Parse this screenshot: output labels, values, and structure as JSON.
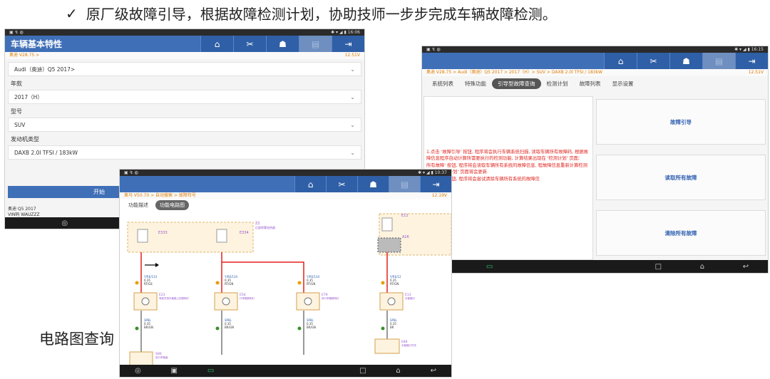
{
  "headline": {
    "check": "✓",
    "text": "原厂级故障引导，根据故障检测计划，协助技师一步步完成车辆故障检测。"
  },
  "caption": "电路图查询",
  "toolbar_icons": [
    "home-icon",
    "tools-icon",
    "user-icon",
    "print-icon",
    "exit-icon"
  ],
  "screen1": {
    "title": "车辆基本特性",
    "version": "奥迪 V28.75 >",
    "voltage": "12.51V",
    "model_select": "Audi（奥迪）Q5 2017>",
    "year_label": "年款",
    "year_value": "2017（H）",
    "type_label": "型号",
    "type_value": "SUV",
    "engine_label": "发动机类型",
    "engine_value": "DAXB 2.0l TFSI / 183kW",
    "start_button": "开始",
    "vehicle_line1": "奥迪 Q5 2017",
    "vehicle_line2": "VIN码 WAUZZZ"
  },
  "screen2": {
    "breadcrumb": "奥迪 V28.75 > Audi（奥迪）Q5 2017 > 2017（H）> SUV > DAXB 2.0l TFSI / 183kW",
    "voltage": "12.51V",
    "tabs": [
      "系统列表",
      "特殊功能",
      "引导型故障查询",
      "检测计划",
      "故障列表",
      "显示设置"
    ],
    "active_tab": 2,
    "guide_lines": [
      "1.点击 '故障引导' 按钮, 程序将会执行车辆系统扫描, 读取车辆所有故障码, 根据故障信息程序自动计算所需要执行的检测功能, 计算结果出现在 '检测计划' 页面;",
      "所有故障' 按钮, 程序将会读取车辆所有系统的故障信息, 程故障信息重新计算检测功能, '检测计划' 页面将会更新.",
      "所有故障' 按钮, 程序将会尝试清除车辆所有系统的故障信"
    ],
    "buttons": [
      "故障引导",
      "读取所有故障",
      "清除所有故障"
    ]
  },
  "screen3": {
    "breadcrumb": "奥马 V50.70 > 自动搜索 > 故障符号",
    "voltage": "12.19V",
    "tabs": [
      "功能描述",
      "功能电路图"
    ],
    "active_tab": 1,
    "labels": {
      "e333": "E333",
      "e334": "E334",
      "z2_a": "Z2",
      "z2_b": "后窗除雾加热器",
      "e12": "E12",
      "a26": "A26",
      "wire_1a": "Y/RE/133",
      "wire_1b": "0.35",
      "wire_1c": "RT/GE",
      "wire_2a": "Y/RE/134",
      "wire_2b": "0.35",
      "wire_2c": "RT/GN",
      "wire_3a": "Y/RE/134",
      "wire_3b": "0.35",
      "wire_3c": "RT/GN",
      "wire_4a": "Y/RE/12",
      "wire_4b": "0.35",
      "wire_4c": "RT/GN",
      "e_1": "E23",
      "e_1b": "驾驶员侧手套箱上的照明灯",
      "e_2": "E54",
      "e_2b": "行李箱照明灯",
      "e_3": "E79",
      "e_3b": "前行李箱照明灯",
      "e_4": "E13",
      "e_4b": "手套箱灯",
      "gnd_1a": "SP8L",
      "gnd_1b": "0.35",
      "gnd_1c": "BR/GN",
      "gnd_2a": "SP8L",
      "gnd_2b": "0.35",
      "gnd_2c": "BR/GN",
      "gnd_3a": "SP8L",
      "gnd_3b": "0.35",
      "gnd_3c": "BR/GN",
      "gnd_4a": "SP8L",
      "gnd_4b": "0.35",
      "gnd_4c": "BR",
      "s1": "S90",
      "s1b": "前行李箱盖",
      "s2": "E84",
      "s2b": "手套箱灯开关"
    }
  },
  "colors": {
    "brand_blue": "#3f6fb7",
    "guide_red": "#e0251f",
    "wire_red": "#e3201b",
    "wire_purple": "#9b59d0"
  }
}
